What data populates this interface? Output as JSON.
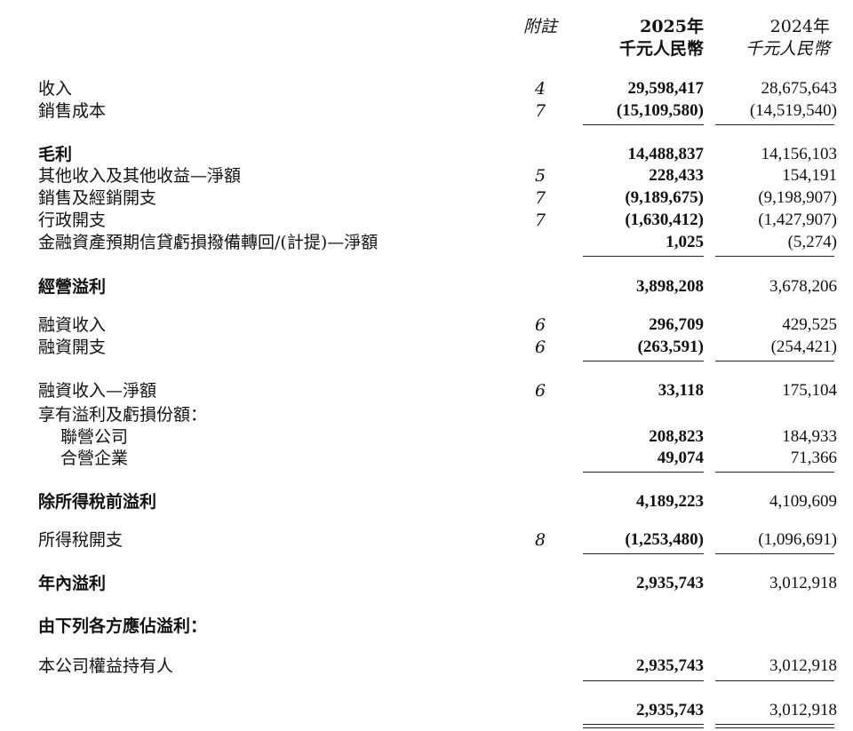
{
  "header": {
    "notes_label": "附註",
    "year_current": "2025年",
    "year_prior": "2024年",
    "unit_current": "千元人民幣",
    "unit_prior": "千元人民幣"
  },
  "rows": {
    "revenue": {
      "label": "收入",
      "note": "4",
      "v2025": "29,598,417",
      "v2024": "28,675,643"
    },
    "cost_of_sales": {
      "label": "銷售成本",
      "note": "7",
      "v2025": "(15,109,580)",
      "v2024": "(14,519,540)"
    },
    "gross_profit": {
      "label": "毛利",
      "v2025": "14,488,837",
      "v2024": "14,156,103"
    },
    "other_income": {
      "label": "其他收入及其他收益—淨額",
      "note": "5",
      "v2025": "228,433",
      "v2024": "154,191"
    },
    "selling_expenses": {
      "label": "銷售及經銷開支",
      "note": "7",
      "v2025": "(9,189,675)",
      "v2024": "(9,198,907)"
    },
    "admin_expenses": {
      "label": "行政開支",
      "note": "7",
      "v2025": "(1,630,412)",
      "v2024": "(1,427,907)"
    },
    "credit_loss": {
      "label": "金融資產預期信貸虧損撥備轉回/(計提)—淨額",
      "v2025": "1,025",
      "v2024": "(5,274)"
    },
    "operating_profit": {
      "label": "經營溢利",
      "v2025": "3,898,208",
      "v2024": "3,678,206"
    },
    "finance_income": {
      "label": "融資收入",
      "note": "6",
      "v2025": "296,709",
      "v2024": "429,525"
    },
    "finance_costs": {
      "label": "融資開支",
      "note": "6",
      "v2025": "(263,591)",
      "v2024": "(254,421)"
    },
    "finance_net": {
      "label": "融資收入—淨額",
      "note": "6",
      "v2025": "33,118",
      "v2024": "175,104"
    },
    "share_header": {
      "label": "享有溢利及虧損份額："
    },
    "associates": {
      "label": "聯營公司",
      "v2025": "208,823",
      "v2024": "184,933"
    },
    "joint_ventures": {
      "label": "合營企業",
      "v2025": "49,074",
      "v2024": "71,366"
    },
    "profit_before_tax": {
      "label": "除所得稅前溢利",
      "v2025": "4,189,223",
      "v2024": "4,109,609"
    },
    "income_tax": {
      "label": "所得稅開支",
      "note": "8",
      "v2025": "(1,253,480)",
      "v2024": "(1,096,691)"
    },
    "profit_for_year": {
      "label": "年內溢利",
      "v2025": "2,935,743",
      "v2024": "3,012,918"
    },
    "attributable_header": {
      "label": "由下列各方應佔溢利："
    },
    "owners": {
      "label": "本公司權益持有人",
      "v2025": "2,935,743",
      "v2024": "3,012,918"
    },
    "total": {
      "v2025": "2,935,743",
      "v2024": "3,012,918"
    }
  }
}
